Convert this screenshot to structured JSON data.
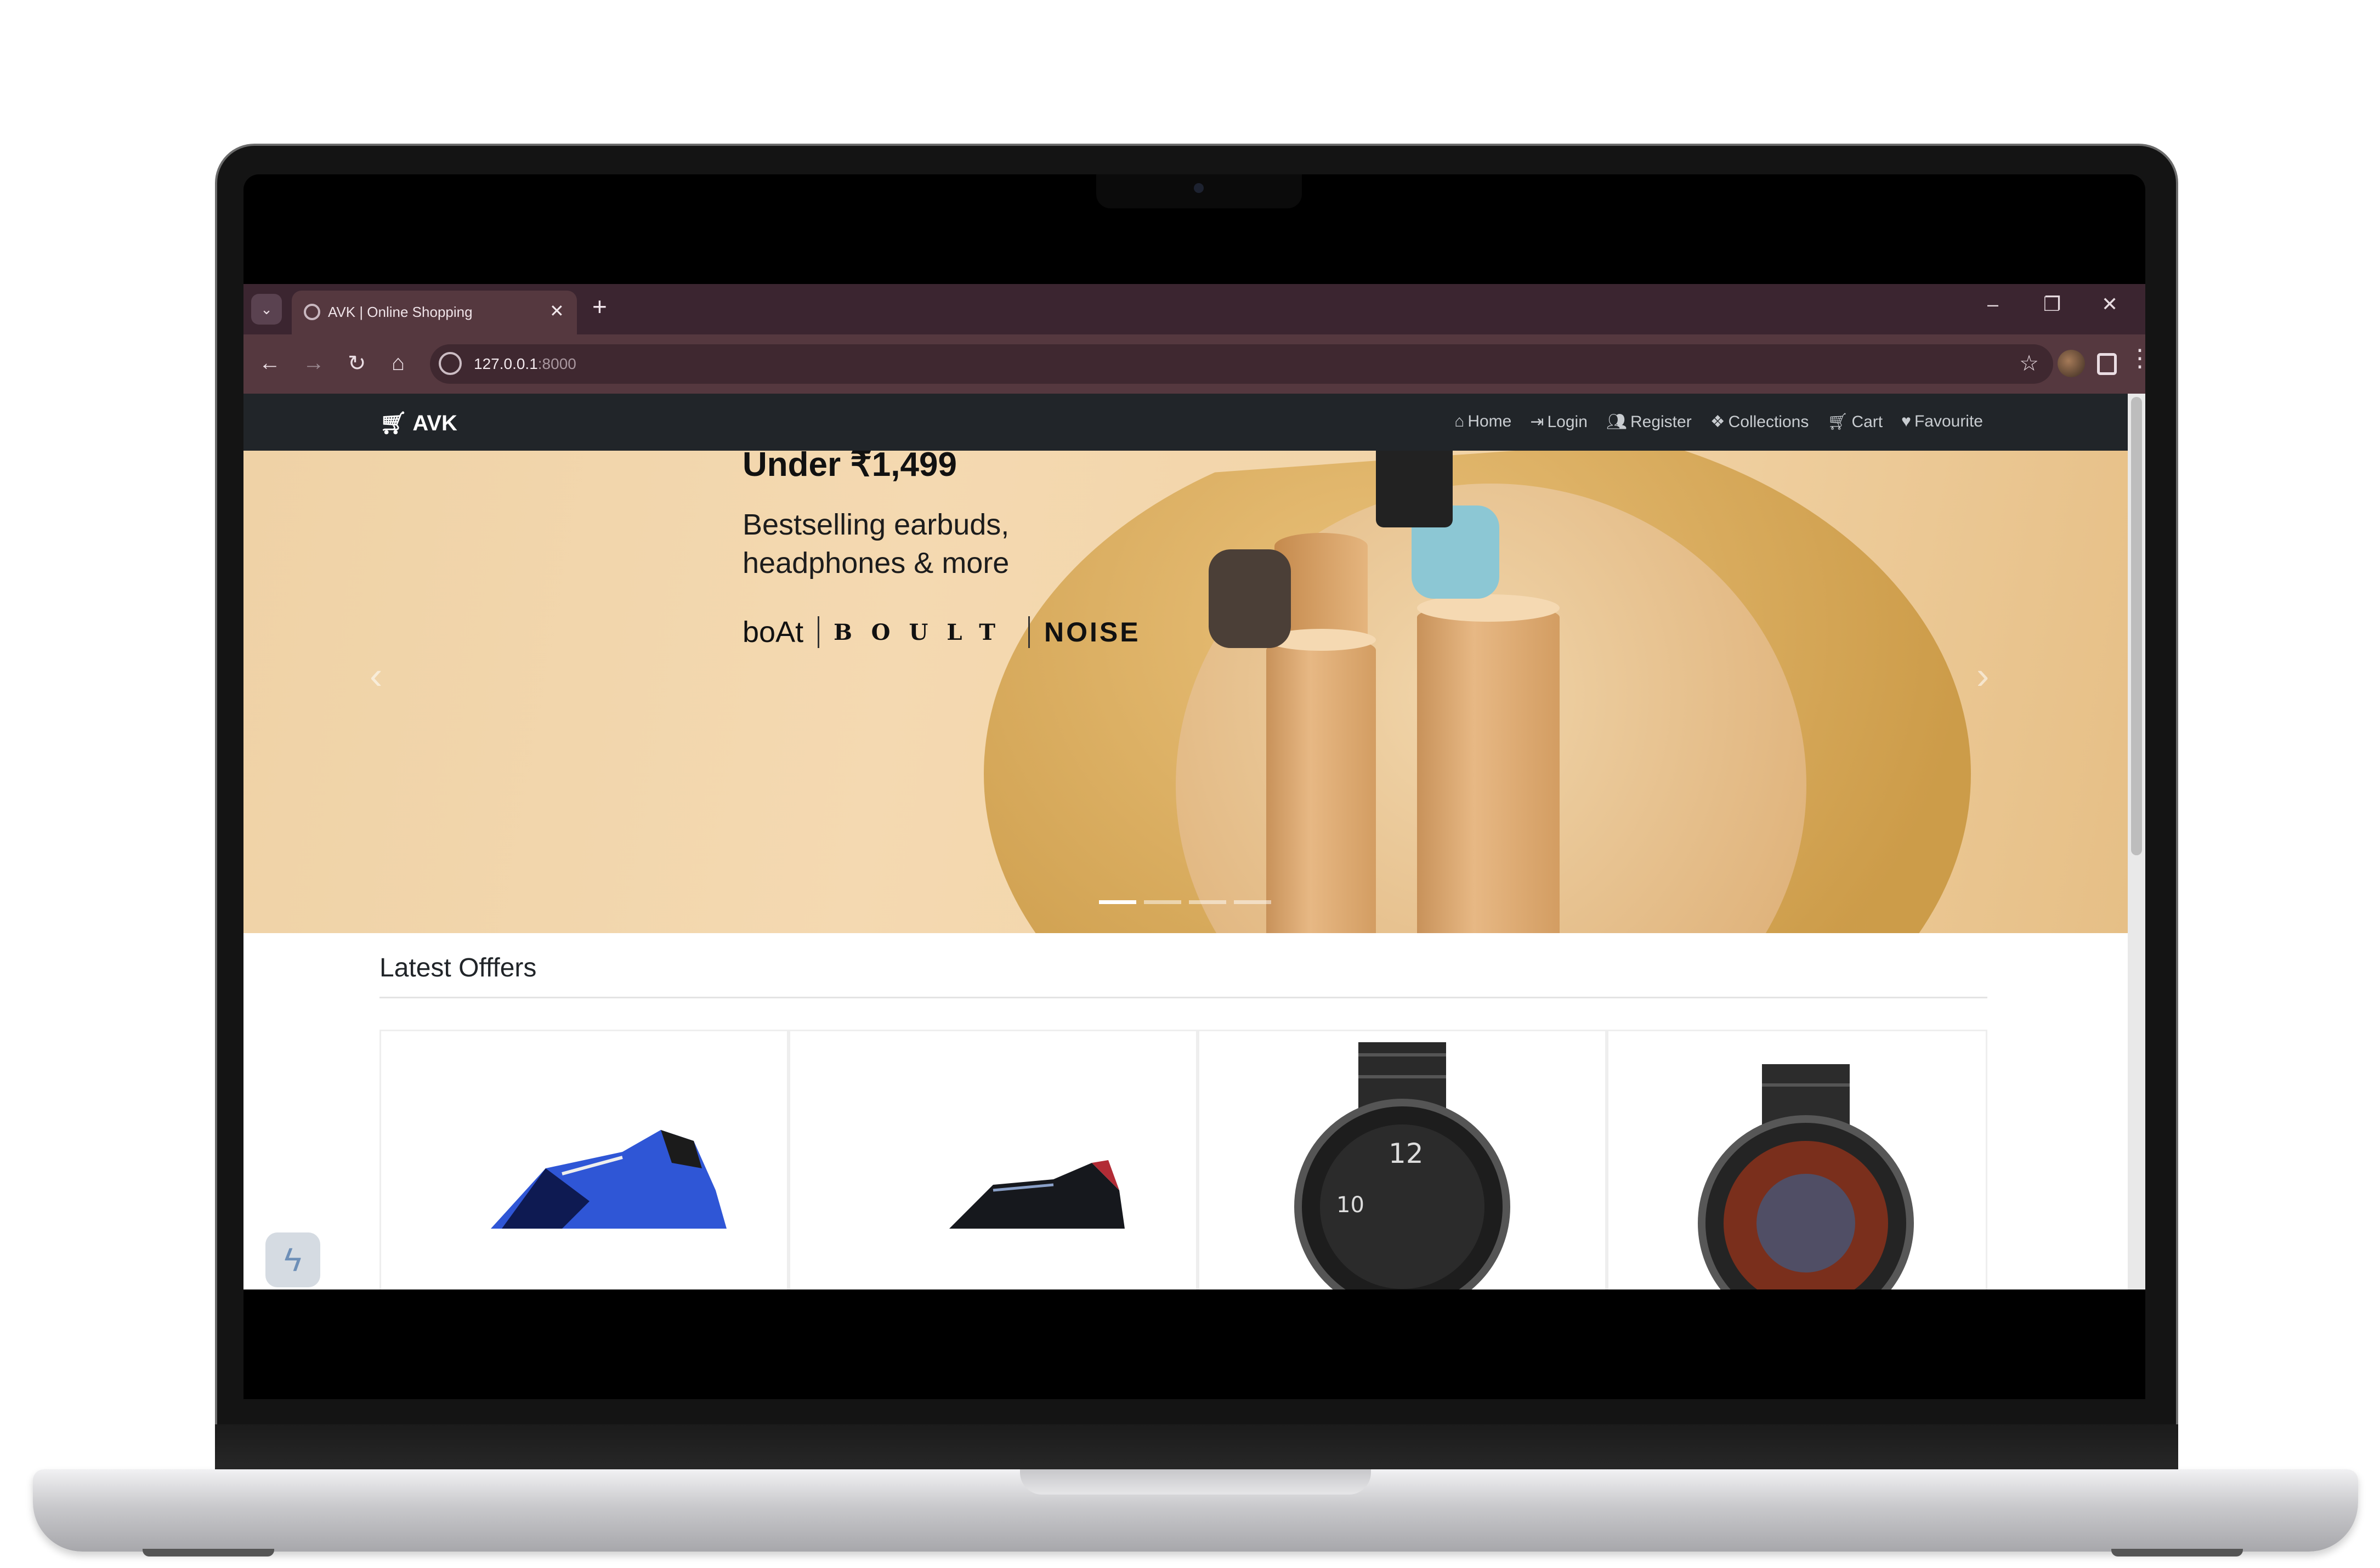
{
  "browser": {
    "tab_title": "AVK | Online Shopping",
    "url_host": "127.0.0.1",
    "url_port": ":8000",
    "new_tab_glyph": "+",
    "tab_close_glyph": "✕",
    "window_controls": [
      "–",
      "❐",
      "✕"
    ]
  },
  "navbar": {
    "brand": "AVK",
    "links": [
      {
        "label": "Home",
        "icon": "home-icon"
      },
      {
        "label": "Login",
        "icon": "login-icon"
      },
      {
        "label": "Register",
        "icon": "register-icon"
      },
      {
        "label": "Collections",
        "icon": "collections-icon"
      },
      {
        "label": "Cart",
        "icon": "cart-icon"
      },
      {
        "label": "Favourite",
        "icon": "heart-icon"
      }
    ]
  },
  "carousel": {
    "headline": "Under ₹1,499",
    "subline_1": "Bestselling earbuds,",
    "subline_2": "headphones & more",
    "brands": [
      "boAt",
      "BOULT",
      "NOISE"
    ],
    "slide_count": 4,
    "active_slide": 1,
    "prev_glyph": "‹",
    "next_glyph": "›"
  },
  "offers": {
    "title": "Latest Offfers",
    "products": [
      {
        "image": "blue-sneaker"
      },
      {
        "image": "black-sneaker"
      },
      {
        "image": "black-chronograph-watch"
      },
      {
        "image": "red-dial-watch"
      }
    ]
  },
  "colors": {
    "navbar_bg": "#212529",
    "browser_chrome": "#55383f",
    "banner_bg": "#f1d2a4"
  }
}
